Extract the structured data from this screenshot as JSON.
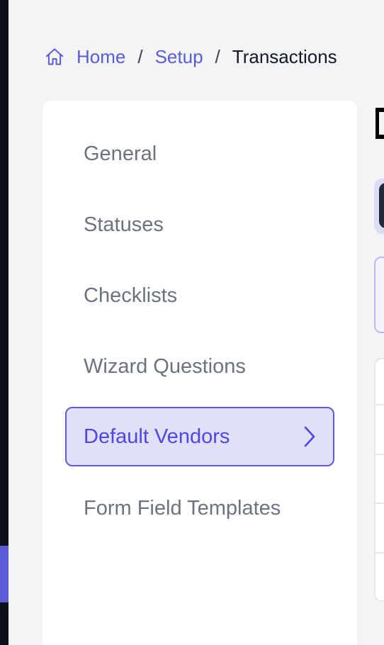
{
  "breadcrumb": {
    "home_icon": "home-icon",
    "items": [
      {
        "label": "Home"
      },
      {
        "label": "Setup"
      },
      {
        "label": "Transactions"
      }
    ],
    "separator": "/"
  },
  "sidebar": {
    "items": [
      {
        "label": "General",
        "active": false
      },
      {
        "label": "Statuses",
        "active": false
      },
      {
        "label": "Checklists",
        "active": false
      },
      {
        "label": "Wizard Questions",
        "active": false
      },
      {
        "label": "Default Vendors",
        "active": true
      },
      {
        "label": "Form Field Templates",
        "active": false
      }
    ]
  },
  "colors": {
    "accent": "#5b5bd6",
    "active_bg": "#e0e0f8",
    "page_bg": "#f3f4f6",
    "muted_text": "#6b7280"
  }
}
